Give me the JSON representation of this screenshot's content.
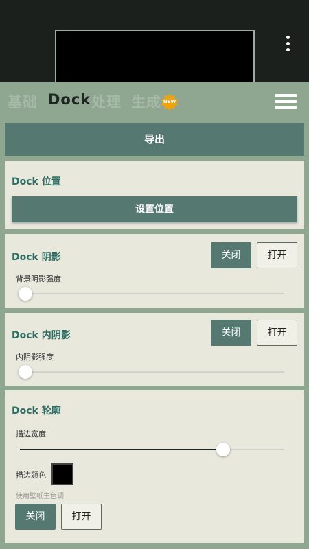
{
  "tabs": [
    {
      "label": "基础",
      "active": false
    },
    {
      "label": "Dock",
      "active": true
    },
    {
      "label": "处理",
      "active": false
    },
    {
      "label": "生成",
      "active": false
    }
  ],
  "new_badge": "NEW",
  "export_label": "导出",
  "dock_position": {
    "title": "Dock 位置",
    "button": "设置位置"
  },
  "dock_shadow": {
    "title": "Dock 阴影",
    "off_label": "关闭",
    "on_label": "打开",
    "slider_label": "背景阴影强度",
    "slider_value": 0.0
  },
  "dock_inner_shadow": {
    "title": "Dock 内阴影",
    "off_label": "关闭",
    "on_label": "打开",
    "slider_label": "内阴影强度",
    "slider_value": 0.0
  },
  "dock_outline": {
    "title": "Dock 轮廓",
    "width_label": "描边宽度",
    "width_value": 0.77,
    "color_label": "描边颜色",
    "color_value": "#000000",
    "hint": "使用壁纸主色调",
    "off_label": "关闭",
    "on_label": "打开"
  },
  "colors": {
    "accent": "#557870",
    "title": "#2c6c63",
    "panel_bg": "#8fa690",
    "card_bg": "#e9e8dd"
  }
}
